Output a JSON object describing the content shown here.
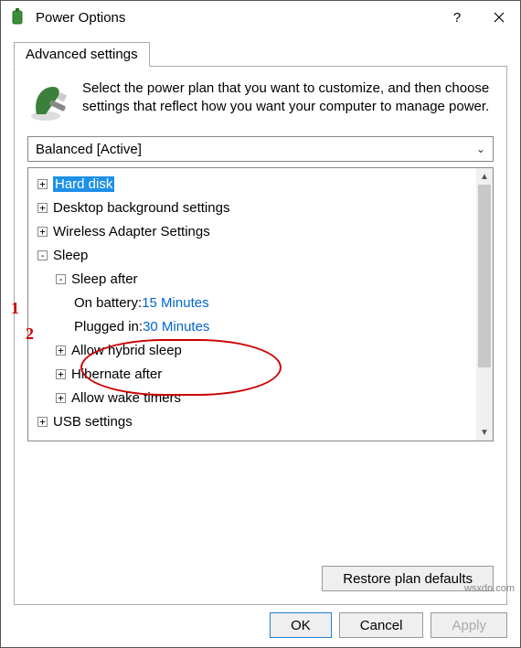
{
  "window": {
    "title": "Power Options"
  },
  "tab": {
    "label": "Advanced settings"
  },
  "description": "Select the power plan that you want to customize, and then choose settings that reflect how you want your computer to manage power.",
  "plan_selected": "Balanced [Active]",
  "tree": {
    "hard_disk": "Hard disk",
    "desktop_bg": "Desktop background settings",
    "wireless": "Wireless Adapter Settings",
    "sleep": "Sleep",
    "sleep_after": "Sleep after",
    "on_battery_label": "On battery: ",
    "on_battery_value": "15 Minutes",
    "plugged_in_label": "Plugged in: ",
    "plugged_in_value": "30 Minutes",
    "hybrid": "Allow hybrid sleep",
    "hibernate": "Hibernate after",
    "wake": "Allow wake timers",
    "usb": "USB settings"
  },
  "buttons": {
    "restore": "Restore plan defaults",
    "ok": "OK",
    "cancel": "Cancel",
    "apply": "Apply"
  },
  "annotations": {
    "one": "1",
    "two": "2"
  },
  "watermark": "wsxdn.com"
}
